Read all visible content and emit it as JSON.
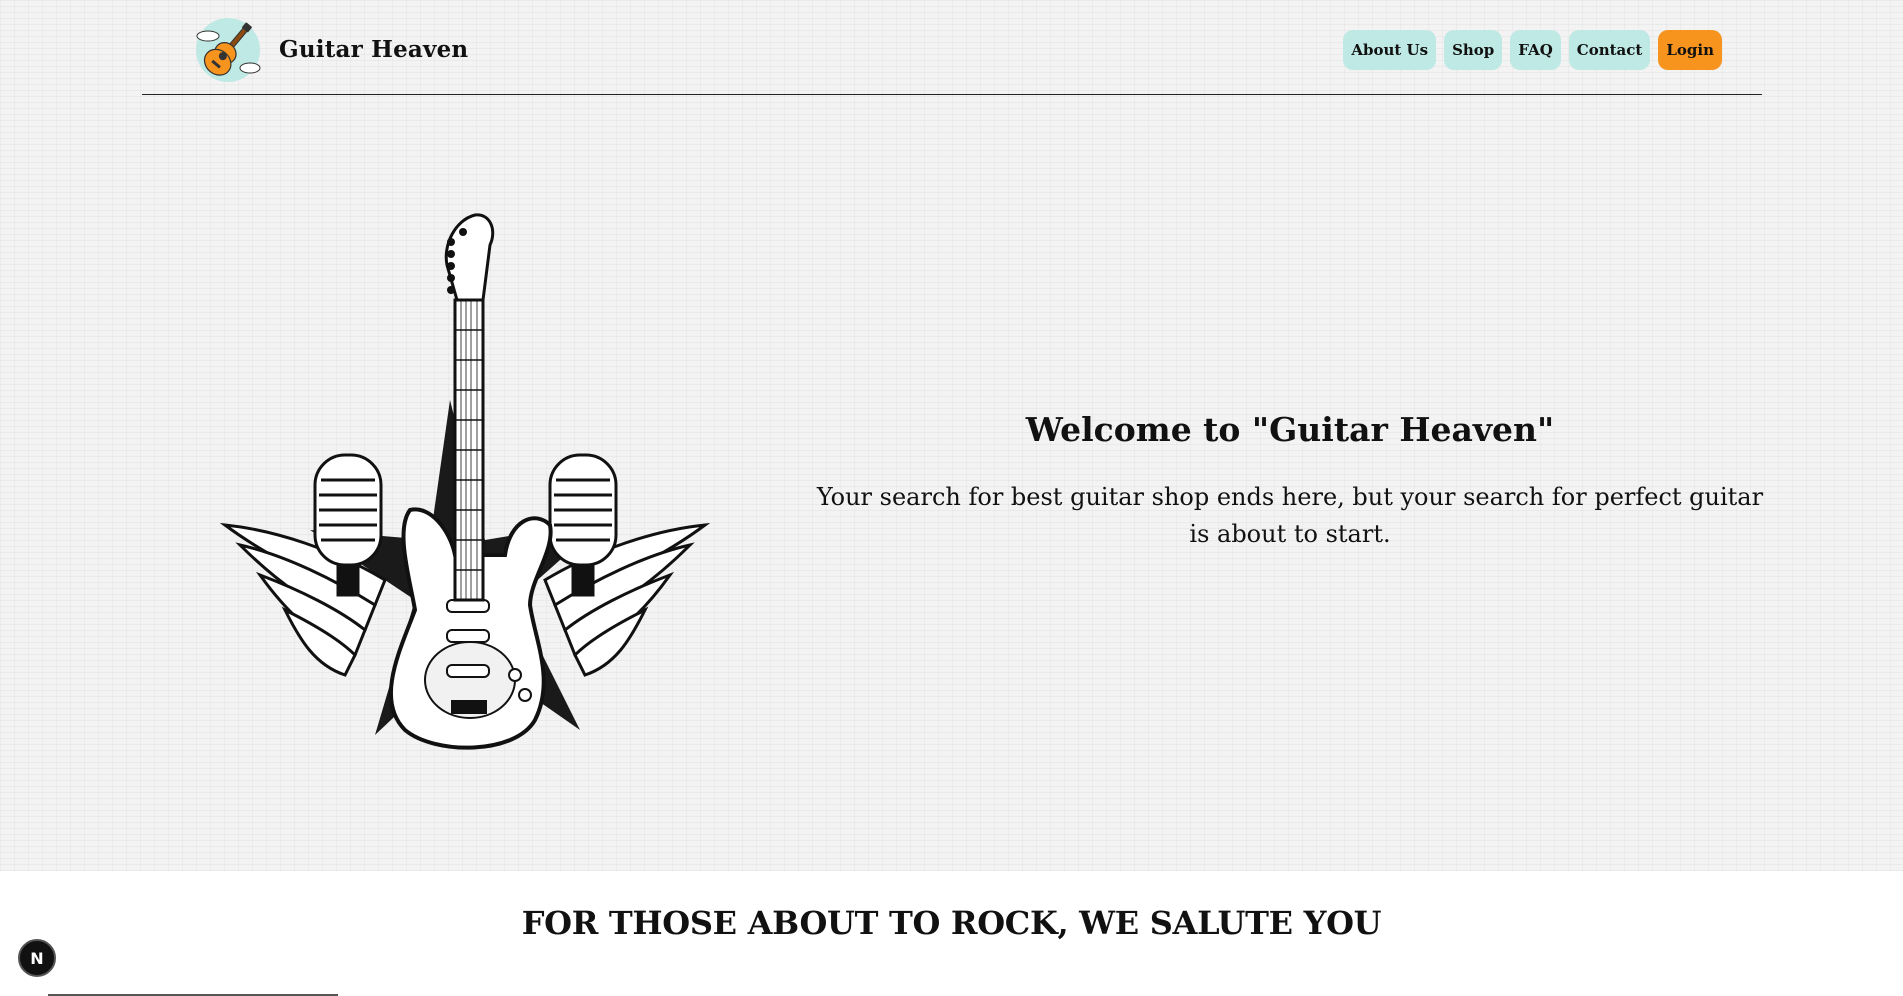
{
  "brand": {
    "name": "Guitar Heaven",
    "logo_icon": "guitar-cloud-logo-icon"
  },
  "nav": {
    "items": [
      "About Us",
      "Shop",
      "FAQ",
      "Contact"
    ],
    "login_label": "Login",
    "item_color": "#bfe9e4",
    "login_color": "#f7941d"
  },
  "hero": {
    "title": "Welcome to \"Guitar Heaven\"",
    "subtitle": "Your search for best guitar shop ends here, but your search for perfect guitar is about to start.",
    "art_icon": "winged-guitar-microphones-icon"
  },
  "tagline": "FOR THOSE ABOUT TO ROCK, WE SALUTE YOU",
  "dev_badge": {
    "label": "N",
    "icon": "nextjs-badge-icon"
  }
}
